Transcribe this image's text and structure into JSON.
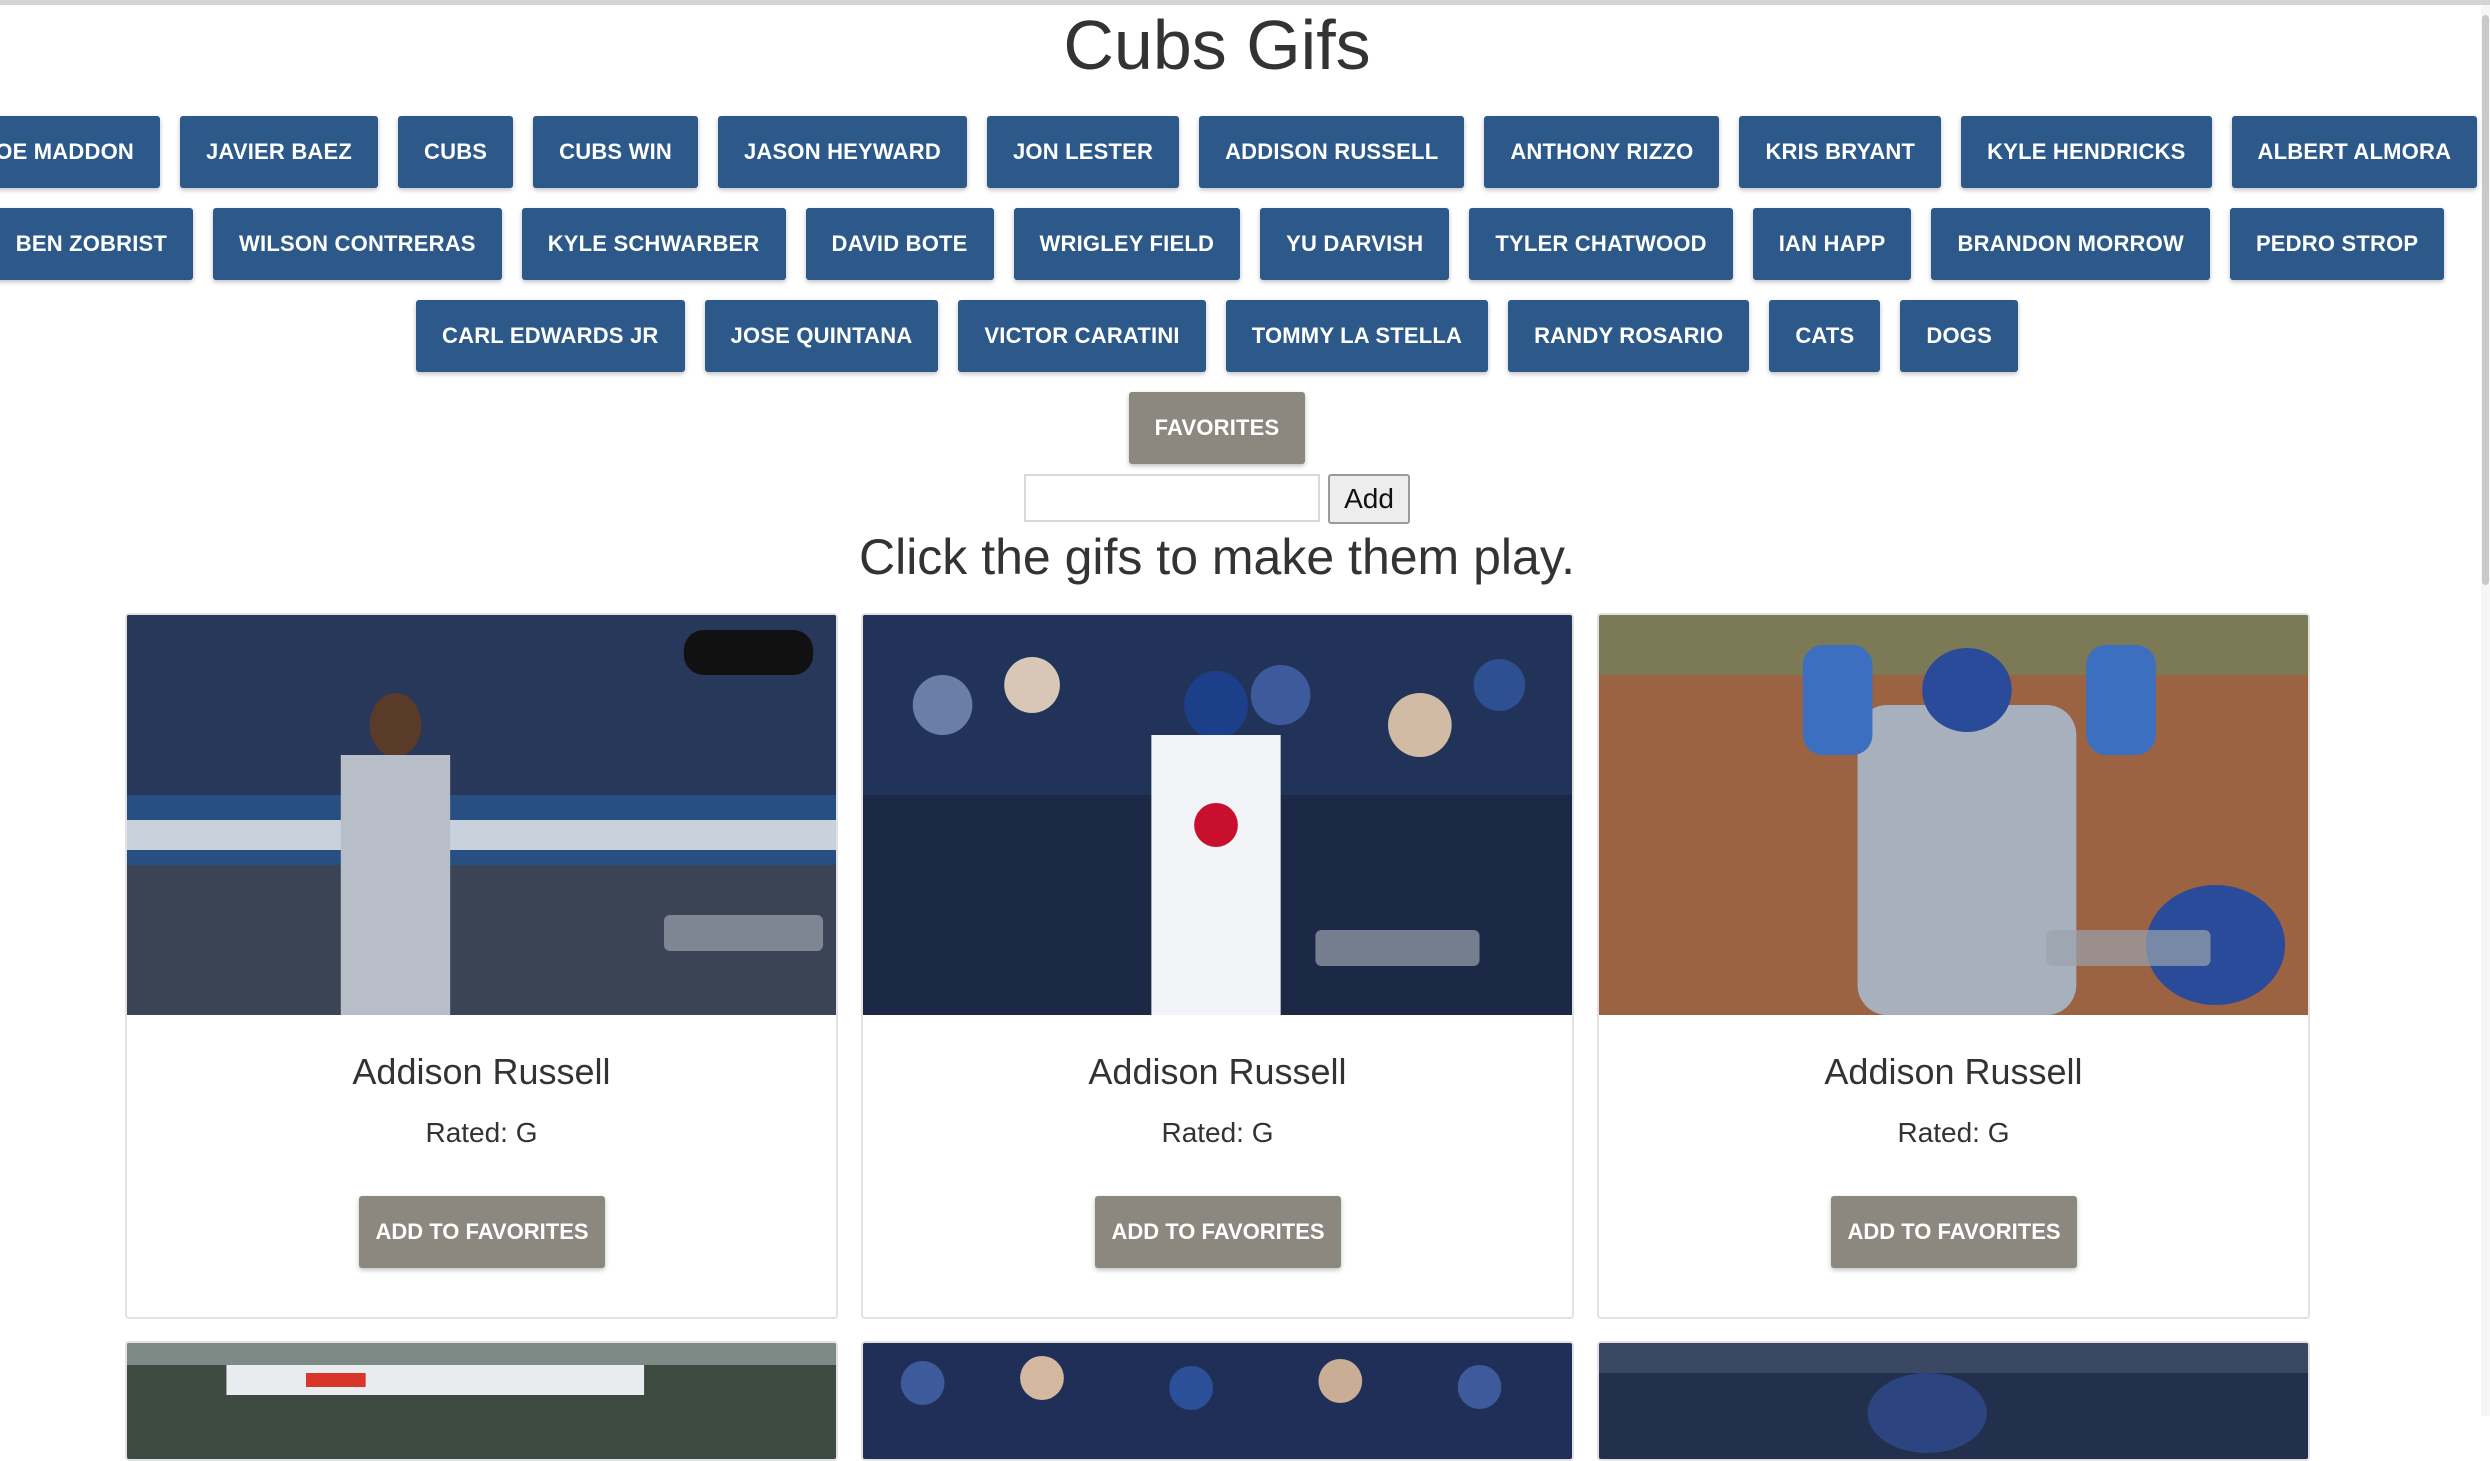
{
  "page": {
    "title": "Cubs Gifs",
    "instructions": "Click the gifs to make them play."
  },
  "topics": {
    "row1": [
      "Joe Maddon",
      "Javier Baez",
      "Cubs",
      "Cubs Win",
      "Jason Heyward",
      "Jon Lester",
      "Addison Russell",
      "Anthony Rizzo",
      "Kris Bryant",
      "Kyle Hendricks",
      "Albert Almora"
    ],
    "row2": [
      "Ben Zobrist",
      "Wilson Contreras",
      "Kyle Schwarber",
      "David Bote",
      "Wrigley Field",
      "Yu Darvish",
      "Tyler Chatwood",
      "Ian Happ",
      "Brandon Morrow",
      "Pedro Strop"
    ],
    "row3": [
      "Carl Edwards Jr",
      "Jose Quintana",
      "Victor Caratini",
      "Tommy La Stella",
      "Randy Rosario",
      "Cats",
      "Dogs"
    ],
    "favorites_label": "Favorites"
  },
  "add_form": {
    "input_value": "",
    "button_label": "Add"
  },
  "gifs": [
    {
      "name": "Addison Russell",
      "rating": "Rated: G",
      "fav_label": "Add to Favorites"
    },
    {
      "name": "Addison Russell",
      "rating": "Rated: G",
      "fav_label": "Add to Favorites"
    },
    {
      "name": "Addison Russell",
      "rating": "Rated: G",
      "fav_label": "Add to Favorites"
    }
  ],
  "colors": {
    "topic_button": "#2c5989",
    "favorites_button": "#8c8880",
    "card_border": "#e2e2e2"
  }
}
